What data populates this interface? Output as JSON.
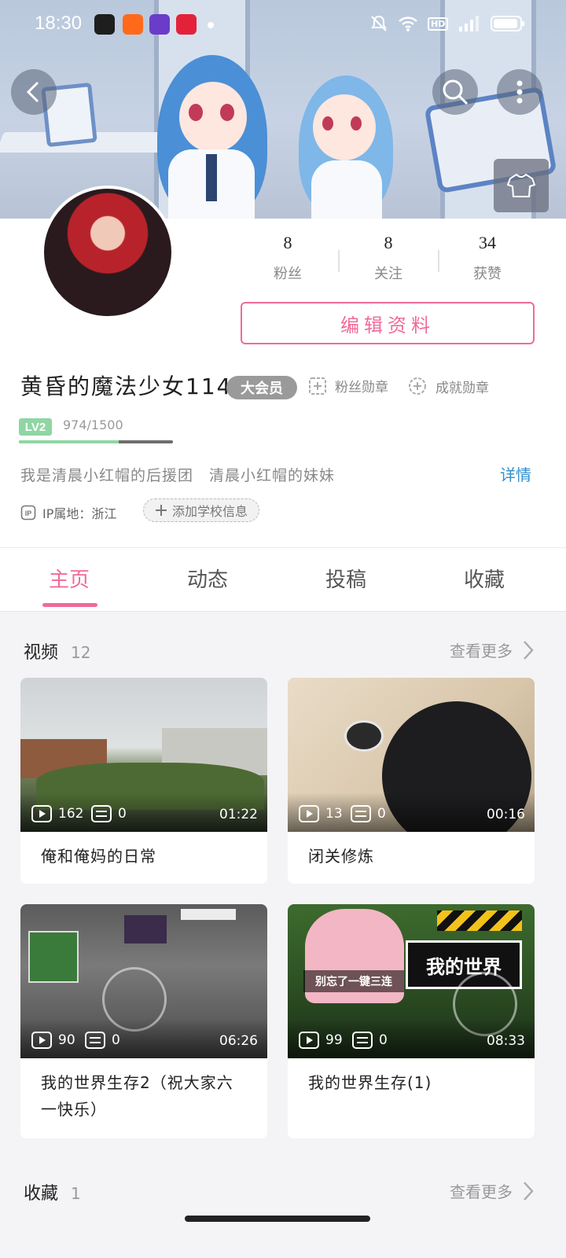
{
  "status_bar": {
    "time": "18:30"
  },
  "profile": {
    "stats": [
      {
        "value": "8",
        "label": "粉丝"
      },
      {
        "value": "8",
        "label": "关注"
      },
      {
        "value": "34",
        "label": "获赞"
      }
    ],
    "edit_label": "编辑资料",
    "username": "黄昏的魔法少女114",
    "vip_label": "大会员",
    "fan_medal_label": "粉丝勋章",
    "achievement_medal_label": "成就勋章",
    "level_label": "LV2",
    "exp_text": "974/1500",
    "exp_progress": 0.649,
    "bio": "我是清晨小红帽的后援团　清晨小红帽的妹妹",
    "bio_more": "详情",
    "ip_label": "IP属地：浙江",
    "school_label": "添加学校信息"
  },
  "tabs": [
    "主页",
    "动态",
    "投稿",
    "收藏"
  ],
  "active_tab": 0,
  "videos_section": {
    "title": "视频",
    "count": "12",
    "more": "查看更多",
    "items": [
      {
        "title": "俺和俺妈的日常",
        "plays": "162",
        "danmaku": "0",
        "duration": "01:22"
      },
      {
        "title": "闭关修炼",
        "plays": "13",
        "danmaku": "0",
        "duration": "00:16"
      },
      {
        "title": "我的世界生存2（祝大家六一快乐）",
        "plays": "90",
        "danmaku": "0",
        "duration": "06:26"
      },
      {
        "title": "我的世界生存(1)",
        "plays": "99",
        "danmaku": "0",
        "duration": "08:33"
      }
    ]
  },
  "favorites_section": {
    "title": "收藏",
    "count": "1",
    "more": "查看更多"
  },
  "thumb_overlay_text": {
    "minecraft_logo": "我的世界",
    "triple_prompt": "别忘了一键三连"
  },
  "colors": {
    "accent": "#f06a9a",
    "link": "#2e8fcf",
    "vip": "#9a9a9a",
    "level": "#8fd6a4"
  }
}
